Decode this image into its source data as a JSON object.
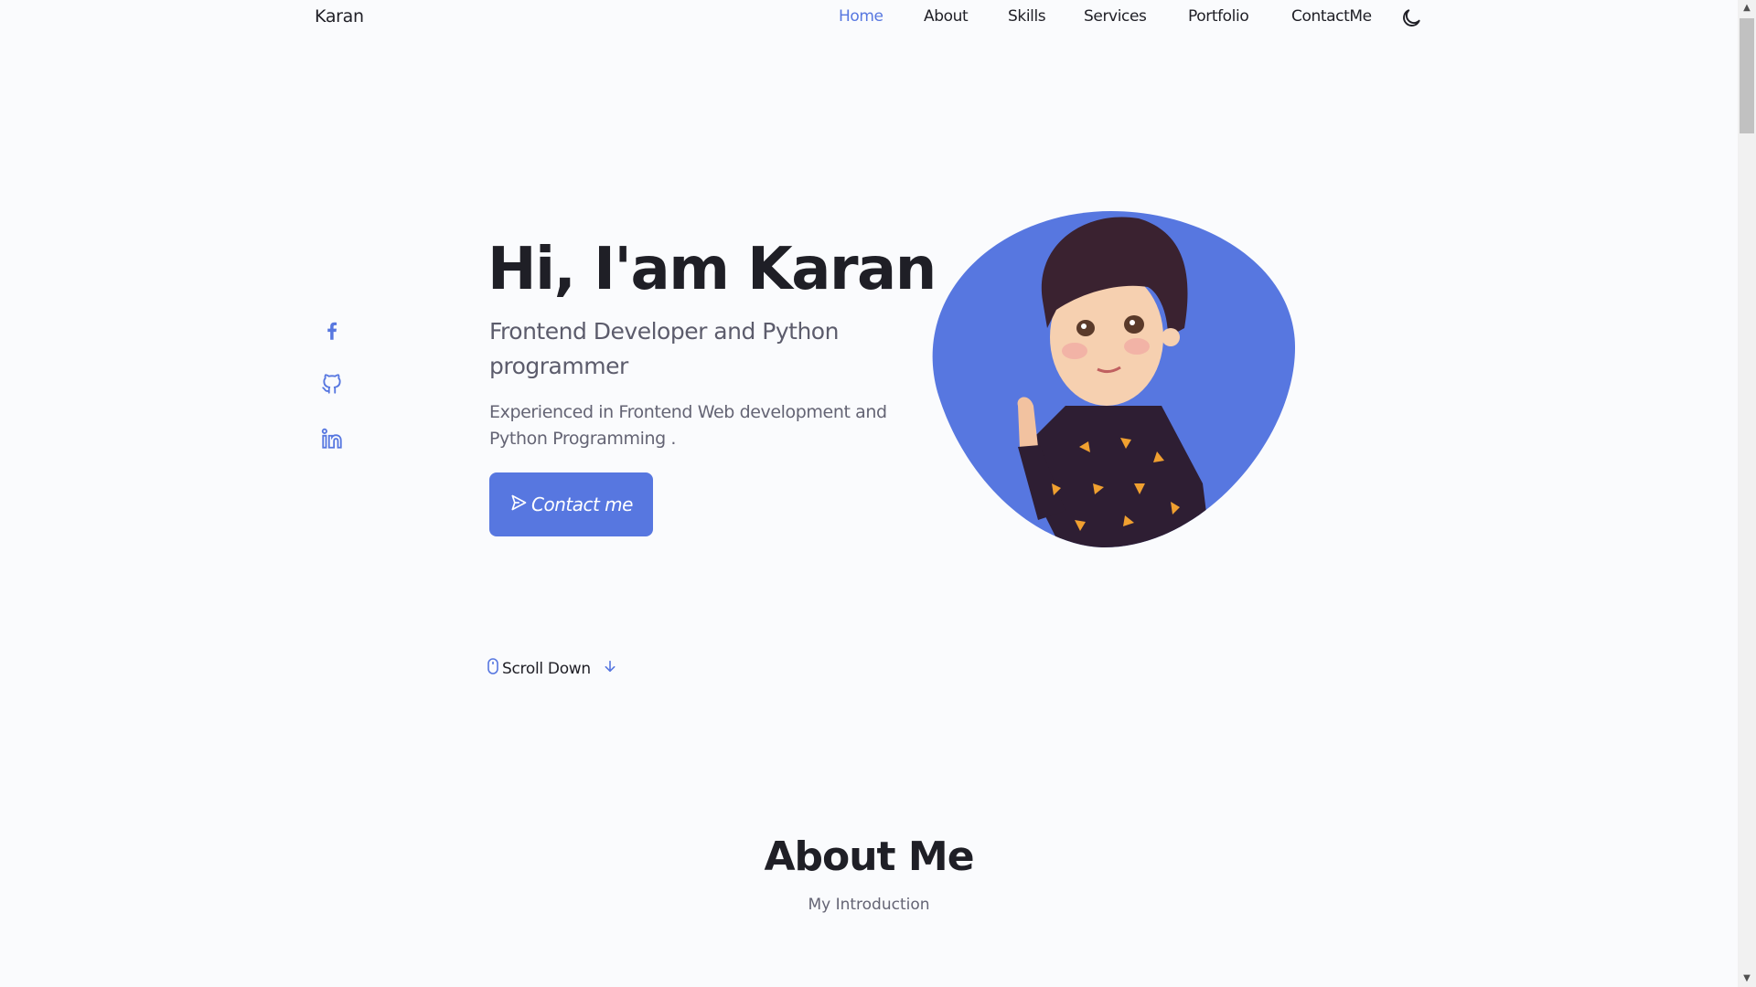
{
  "nav": {
    "logo": "Karan",
    "items": [
      {
        "label": "Home",
        "active": true
      },
      {
        "label": "About"
      },
      {
        "label": "Skills"
      },
      {
        "label": "Services"
      },
      {
        "label": "Portfolio"
      },
      {
        "label": "ContactMe"
      }
    ],
    "theme_toggle_icon": "moon-icon"
  },
  "social": [
    {
      "icon": "facebook-icon"
    },
    {
      "icon": "github-icon"
    },
    {
      "icon": "linkedin-icon"
    }
  ],
  "hero": {
    "title": "Hi, I'am Karan",
    "subtitle": "Frontend Developer and Python programmer",
    "description": "Experienced in Frontend Web development and Python Programming .",
    "button_label": "Contact me",
    "scroll_label": "Scroll Down"
  },
  "about": {
    "title": "About Me",
    "subtitle": "My Introduction"
  },
  "colors": {
    "accent": "#5777e0",
    "text": "#1f1f26",
    "background": "#fafbfd"
  }
}
